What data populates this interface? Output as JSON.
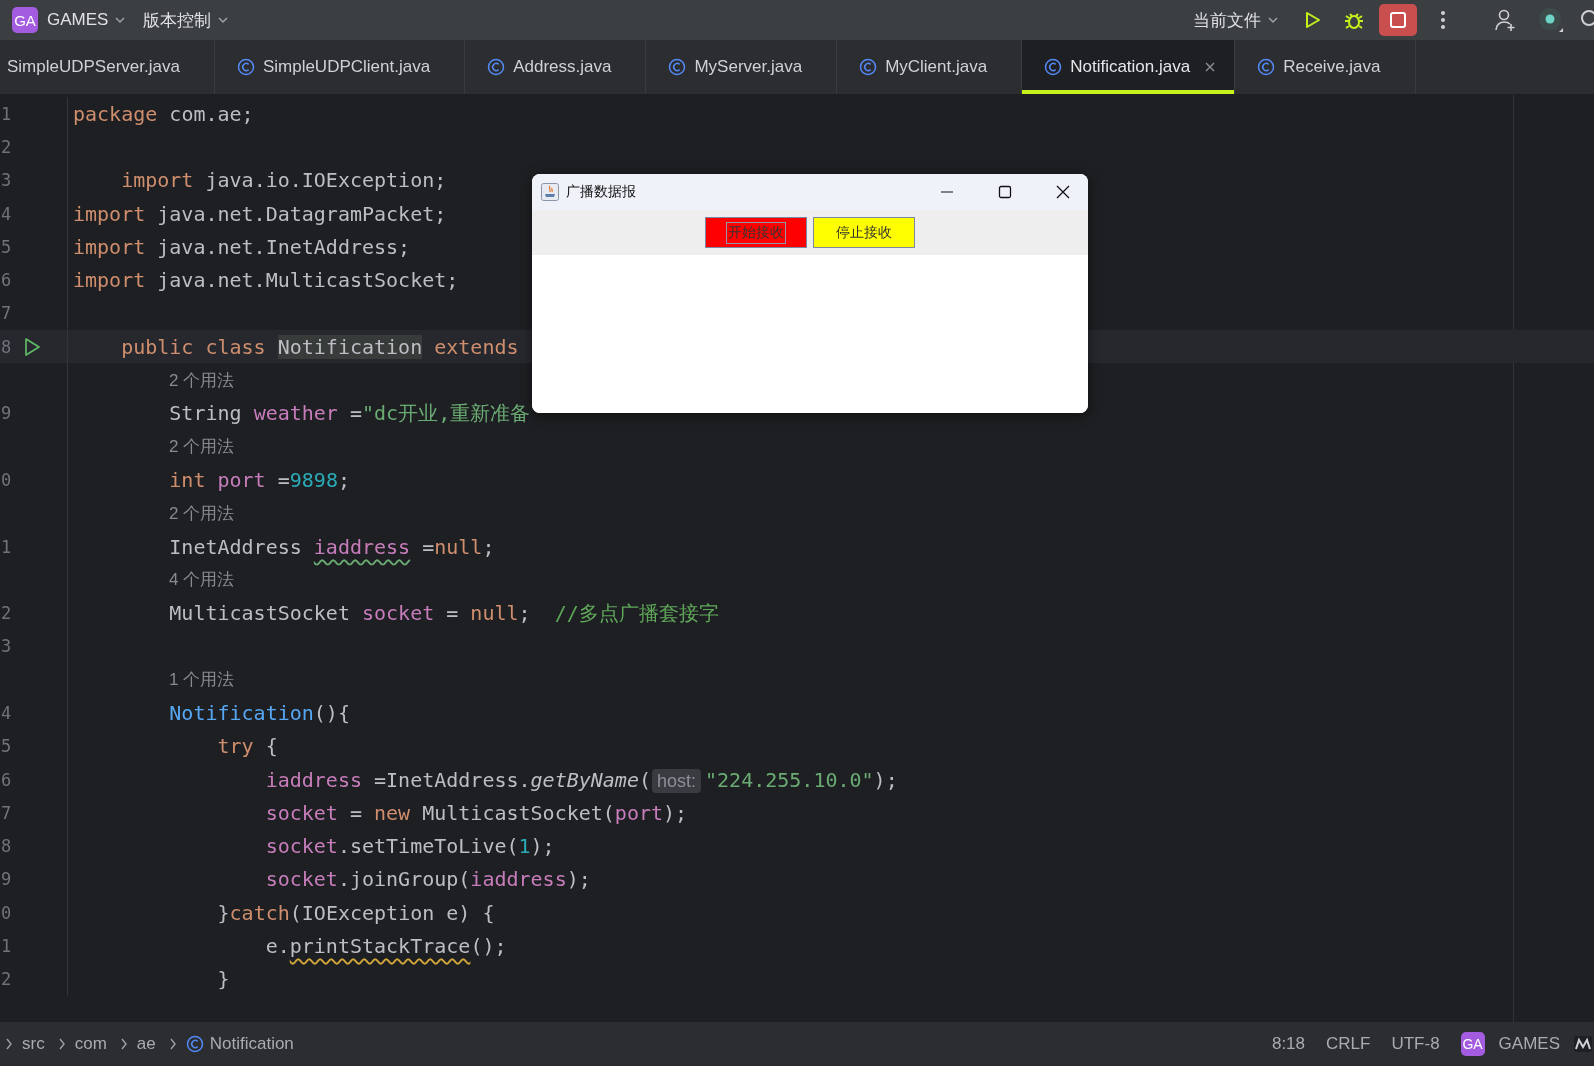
{
  "toolbar": {
    "project_badge": "GA",
    "project": "GAMES",
    "vcs": "版本控制",
    "run_config": "当前文件"
  },
  "tabs": [
    {
      "label": "SimpleUDPServer.java",
      "icon": false,
      "selected": false
    },
    {
      "label": "SimpleUDPClient.java",
      "icon": true,
      "selected": false
    },
    {
      "label": "Address.java",
      "icon": true,
      "selected": false
    },
    {
      "label": "MyServer.java",
      "icon": true,
      "selected": false
    },
    {
      "label": "MyClient.java",
      "icon": true,
      "selected": false
    },
    {
      "label": "Notification.java",
      "icon": true,
      "selected": true
    },
    {
      "label": "Receive.java",
      "icon": true,
      "selected": false
    }
  ],
  "editor": {
    "lines": [
      {
        "kind": "code",
        "number": "1",
        "run": false,
        "current": false,
        "tokens": [
          {
            "kind": "kw",
            "text": "package"
          },
          {
            "kind": "plain",
            "text": " com.ae;"
          }
        ]
      },
      {
        "kind": "code",
        "number": "2",
        "run": false,
        "current": false
      },
      {
        "kind": "code",
        "number": "3",
        "run": false,
        "current": false,
        "tokens": [
          {
            "kind": "kw",
            "text": "    import"
          },
          {
            "kind": "plain",
            "text": " java.io.IOException;"
          }
        ]
      },
      {
        "kind": "code",
        "number": "4",
        "run": false,
        "current": false,
        "tokens": [
          {
            "kind": "kw",
            "text": "import"
          },
          {
            "kind": "plain",
            "text": " java.net.DatagramPacket;"
          }
        ]
      },
      {
        "kind": "code",
        "number": "5",
        "run": false,
        "current": false,
        "tokens": [
          {
            "kind": "kw",
            "text": "import"
          },
          {
            "kind": "plain",
            "text": " java.net.InetAddress;"
          }
        ]
      },
      {
        "kind": "code",
        "number": "6",
        "run": false,
        "current": false,
        "tokens": [
          {
            "kind": "kw",
            "text": "import"
          },
          {
            "kind": "plain",
            "text": " java.net.MulticastSocket;"
          }
        ]
      },
      {
        "kind": "code",
        "number": "7",
        "run": false,
        "current": false
      },
      {
        "kind": "code",
        "number": "8",
        "run": true,
        "current": true,
        "tokens": [
          {
            "kind": "kw",
            "text": "    public class "
          },
          {
            "kind": "highlight",
            "text": "Notification"
          },
          {
            "kind": "kw",
            "text": " extends"
          }
        ]
      },
      {
        "kind": "hint",
        "text": "2 个用法"
      },
      {
        "kind": "code",
        "number": "9",
        "run": false,
        "current": false,
        "tokens": [
          {
            "kind": "plain",
            "text": "        String "
          },
          {
            "kind": "field",
            "text": "weather"
          },
          {
            "kind": "plain",
            "text": " ="
          },
          {
            "kind": "str",
            "text": "\"dc开业,重新准备"
          }
        ]
      },
      {
        "kind": "hint",
        "text": "2 个用法"
      },
      {
        "kind": "code",
        "number": "0",
        "run": false,
        "current": false,
        "tokens": [
          {
            "kind": "kw",
            "text": "        int "
          },
          {
            "kind": "field",
            "text": "port"
          },
          {
            "kind": "plain",
            "text": " ="
          },
          {
            "kind": "num",
            "text": "9898"
          },
          {
            "kind": "plain",
            "text": ";"
          }
        ]
      },
      {
        "kind": "hint",
        "text": "2 个用法"
      },
      {
        "kind": "code",
        "number": "1",
        "run": false,
        "current": false,
        "tokens": [
          {
            "kind": "plain",
            "text": "        InetAddress "
          },
          {
            "kind": "field",
            "text": "iaddress",
            "typo": true
          },
          {
            "kind": "plain",
            "text": " ="
          },
          {
            "kind": "kw",
            "text": "null"
          },
          {
            "kind": "plain",
            "text": ";"
          }
        ]
      },
      {
        "kind": "hint",
        "text": "4 个用法"
      },
      {
        "kind": "code",
        "number": "2",
        "run": false,
        "current": false,
        "tokens": [
          {
            "kind": "plain",
            "text": "        MulticastSocket "
          },
          {
            "kind": "field",
            "text": "socket"
          },
          {
            "kind": "plain",
            "text": " = "
          },
          {
            "kind": "kw",
            "text": "null"
          },
          {
            "kind": "plain",
            "text": ";  "
          },
          {
            "kind": "comment",
            "text": "//多点广播套接字"
          }
        ]
      },
      {
        "kind": "code",
        "number": "3",
        "run": false,
        "current": false
      },
      {
        "kind": "hint",
        "text": "1 个用法"
      },
      {
        "kind": "code",
        "number": "4",
        "run": false,
        "current": false,
        "tokens": [
          {
            "kind": "decl",
            "text": "        Notification"
          },
          {
            "kind": "plain",
            "text": "(){"
          }
        ]
      },
      {
        "kind": "code",
        "number": "5",
        "run": false,
        "current": false,
        "tokens": [
          {
            "kind": "kw",
            "text": "            try"
          },
          {
            "kind": "plain",
            "text": " {"
          }
        ]
      },
      {
        "kind": "code",
        "number": "6",
        "run": false,
        "current": false,
        "tokens": [
          {
            "kind": "field",
            "text": "                iaddress"
          },
          {
            "kind": "plain",
            "text": " =InetAddress."
          },
          {
            "kind": "italic",
            "text": "getByName"
          },
          {
            "kind": "plain",
            "text": "("
          },
          {
            "kind": "param",
            "text": "host:"
          },
          {
            "kind": "str",
            "text": "\"224.255.10.0\""
          },
          {
            "kind": "plain",
            "text": ");"
          }
        ]
      },
      {
        "kind": "code",
        "number": "7",
        "run": false,
        "current": false,
        "tokens": [
          {
            "kind": "field",
            "text": "                socket"
          },
          {
            "kind": "plain",
            "text": " = "
          },
          {
            "kind": "kw",
            "text": "new"
          },
          {
            "kind": "plain",
            "text": " MulticastSocket("
          },
          {
            "kind": "field",
            "text": "port"
          },
          {
            "kind": "plain",
            "text": ");"
          }
        ]
      },
      {
        "kind": "code",
        "number": "8",
        "run": false,
        "current": false,
        "tokens": [
          {
            "kind": "field",
            "text": "                socket"
          },
          {
            "kind": "plain",
            "text": ".setTimeToLive("
          },
          {
            "kind": "num",
            "text": "1"
          },
          {
            "kind": "plain",
            "text": ");"
          }
        ]
      },
      {
        "kind": "code",
        "number": "9",
        "run": false,
        "current": false,
        "tokens": [
          {
            "kind": "field",
            "text": "                socket"
          },
          {
            "kind": "plain",
            "text": ".joinGroup("
          },
          {
            "kind": "field",
            "text": "iaddress"
          },
          {
            "kind": "plain",
            "text": ");"
          }
        ]
      },
      {
        "kind": "code",
        "number": "0",
        "run": false,
        "current": false,
        "tokens": [
          {
            "kind": "plain",
            "text": "            }"
          },
          {
            "kind": "kw",
            "text": "catch"
          },
          {
            "kind": "plain",
            "text": "(IOException e) {"
          }
        ]
      },
      {
        "kind": "code",
        "number": "1",
        "run": false,
        "current": false,
        "tokens": [
          {
            "kind": "plain",
            "text": "                e."
          },
          {
            "kind": "plain",
            "text": "printStackTrace",
            "warning": true
          },
          {
            "kind": "plain",
            "text": "();"
          }
        ]
      },
      {
        "kind": "code",
        "number": "2",
        "run": false,
        "current": false,
        "tokens": [
          {
            "kind": "plain",
            "text": "            }"
          }
        ]
      }
    ]
  },
  "dialog": {
    "title": "广播数据报",
    "buttons": [
      {
        "label": "开始接收",
        "color": "#ff0000",
        "focused": true
      },
      {
        "label": "停止接收",
        "color": "#ffff00",
        "focused": false
      }
    ]
  },
  "status_bar": {
    "breadcrumbs": [
      {
        "label": "src",
        "icon": false
      },
      {
        "label": "com",
        "icon": false
      },
      {
        "label": "ae",
        "icon": false
      },
      {
        "label": "Notification",
        "icon": true
      }
    ],
    "position": "8:18",
    "line_ending": "CRLF",
    "encoding": "UTF-8",
    "project_badge": "GA",
    "project": "GAMES"
  }
}
